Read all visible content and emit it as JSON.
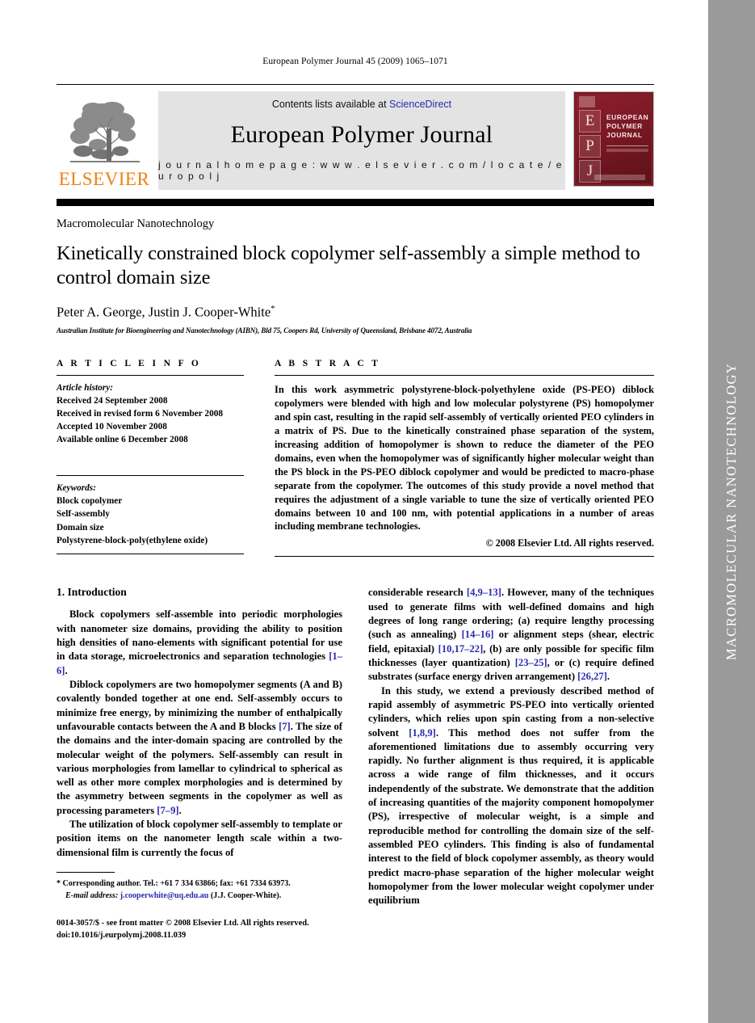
{
  "running_head": "European Polymer Journal 45 (2009) 1065–1071",
  "masthead": {
    "contents_prefix": "Contents lists available at ",
    "sciencedirect": "ScienceDirect",
    "journal_title": "European Polymer Journal",
    "homepage": "j o u r n a l   h o m e p a g e :   w w w . e l s e v i e r . c o m / l o c a t e / e u r o p o l j",
    "publisher": "ELSEVIER",
    "cover_letters": [
      "E",
      "P",
      "J"
    ],
    "cover_title": "EUROPEAN POLYMER JOURNAL",
    "link_color": "#2a2ab0",
    "cover_color": "#7d1b27",
    "elsevier_orange": "#f07f13"
  },
  "section_label": "Macromolecular Nanotechnology",
  "title": "Kinetically constrained block copolymer self-assembly a simple method to control domain size",
  "authors": "Peter A. George, Justin J. Cooper-White",
  "author_marker": "*",
  "affiliation": "Australian Institute for Bioengineering and Nanotechnology (AIBN), Bld 75, Coopers Rd, University of Queensland, Brisbane 4072, Australia",
  "article_info": {
    "heading": "A R T I C L E    I N F O",
    "history_label": "Article history:",
    "history": [
      "Received 24 September 2008",
      "Received in revised form 6 November 2008",
      "Accepted 10 November 2008",
      "Available online 6 December 2008"
    ],
    "keywords_label": "Keywords:",
    "keywords": [
      "Block copolymer",
      "Self-assembly",
      "Domain size",
      "Polystyrene-block-poly(ethylene oxide)"
    ]
  },
  "abstract": {
    "heading": "A B S T R A C T",
    "text": "In this work asymmetric polystyrene-block-polyethylene oxide (PS-PEO) diblock copolymers were blended with high and low molecular polystyrene (PS) homopolymer and spin cast, resulting in the rapid self-assembly of vertically oriented PEO cylinders in a matrix of PS. Due to the kinetically constrained phase separation of the system, increasing addition of homopolymer is shown to reduce the diameter of the PEO domains, even when the homopolymer was of significantly higher molecular weight than the PS block in the PS-PEO diblock copolymer and would be predicted to macro-phase separate from the copolymer. The outcomes of this study provide a novel method that requires the adjustment of a single variable to tune the size of vertically oriented PEO domains between 10 and 100 nm, with potential applications in a number of areas including membrane technologies.",
    "copyright": "© 2008 Elsevier Ltd. All rights reserved."
  },
  "body": {
    "intro_heading": "1. Introduction",
    "left_paragraphs": [
      "Block copolymers self-assemble into periodic morphologies with nanometer size domains, providing the ability to position high densities of nano-elements with significant potential for use in data storage, microelectronics and separation technologies [1–6].",
      "Diblock copolymers are two homopolymer segments (A and B) covalently bonded together at one end. Self-assembly occurs to minimize free energy, by minimizing the number of enthalpically unfavourable contacts between the A and B blocks [7]. The size of the domains and the inter-domain spacing are controlled by the molecular weight of the polymers. Self-assembly can result in various morphologies from lamellar to cylindrical to spherical as well as other more complex morphologies and is determined by the asymmetry between segments in the copolymer as well as processing parameters [7–9].",
      "The utilization of block copolymer self-assembly to template or position items on the nanometer length scale within a two-dimensional film is currently the focus of"
    ],
    "right_paragraphs": [
      "considerable research [4,9–13]. However, many of the techniques used to generate films with well-defined domains and high degrees of long range ordering; (a) require lengthy processing (such as annealing) [14–16] or alignment steps (shear, electric field, epitaxial) [10,17–22], (b) are only possible for specific film thicknesses (layer quantization) [23–25], or (c) require defined substrates (surface energy driven arrangement) [26,27].",
      "In this study, we extend a previously described method of rapid assembly of asymmetric PS-PEO into vertically oriented cylinders, which relies upon spin casting from a non-selective solvent [1,8,9]. This method does not suffer from the aforementioned limitations due to assembly occurring very rapidly. No further alignment is thus required, it is applicable across a wide range of film thicknesses, and it occurs independently of the substrate. We demonstrate that the addition of increasing quantities of the majority component homopolymer (PS), irrespective of molecular weight, is a simple and reproducible method for controlling the domain size of the self-assembled PEO cylinders. This finding is also of fundamental interest to the field of block copolymer assembly, as theory would predict macro-phase separation of the higher molecular weight homopolymer from the lower molecular weight copolymer under equilibrium"
    ]
  },
  "footnote": {
    "marker": "*",
    "text": "Corresponding author. Tel.: +61 7 334 63866; fax: +61 7334 63973.",
    "email_label": "E-mail address:",
    "email": "j.cooperwhite@uq.edu.au",
    "email_owner": "(J.J. Cooper-White)."
  },
  "issn_line_1": "0014-3057/$ - see front matter © 2008 Elsevier Ltd. All rights reserved.",
  "issn_line_2": "doi:10.1016/j.eurpolymj.2008.11.039",
  "side_band": {
    "text": "MACROMOLECULAR NANOTECHNOLOGY",
    "bg_color": "#9a9a9a",
    "text_color": "#ffffff"
  }
}
